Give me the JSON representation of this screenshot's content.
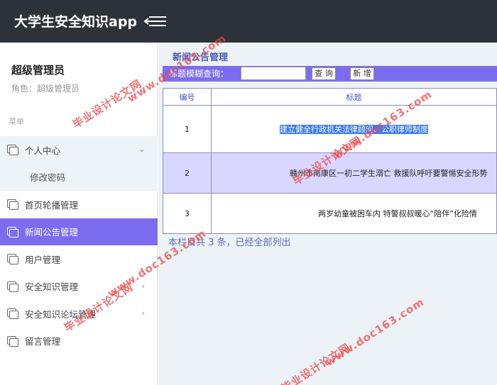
{
  "header": {
    "title": "大学生安全知识app"
  },
  "sidebar": {
    "user_name": "超级管理员",
    "user_role": "角色：超级管理员",
    "section_label": "菜单",
    "items": [
      {
        "label": "个人中心",
        "icon": "pages-icon",
        "caret": "⌄"
      },
      {
        "label": "修改密码"
      },
      {
        "label": "首页轮播管理",
        "icon": "pages-icon"
      },
      {
        "label": "新闻公告管理",
        "icon": "pages-icon"
      },
      {
        "label": "用户管理",
        "icon": "pages-icon"
      },
      {
        "label": "安全知识管理",
        "icon": "pages-icon",
        "caret": "‹"
      },
      {
        "label": "安全知识论坛管理",
        "icon": "pages-icon",
        "caret": "‹"
      },
      {
        "label": "留言管理",
        "icon": "pages-icon"
      }
    ]
  },
  "main": {
    "breadcrumb": "新闻公告管理",
    "search": {
      "label": "标题模糊查询：",
      "value": "",
      "query_button": "查 询",
      "add_button": "新 增"
    },
    "table": {
      "headers": [
        "编号",
        "标题"
      ],
      "rows": [
        {
          "id": "1",
          "title_selected": "建立健全行政机关法律顾问、公职律师制度",
          "title": ""
        },
        {
          "id": "2",
          "title": "赣州市南康区一初二学生溺亡 救援队呼吁要警惕安全形势"
        },
        {
          "id": "3",
          "title": "两岁幼童被困车内 特警叔叔暖心“陪伴”化险情"
        }
      ]
    },
    "summary": "本栏目共 3 条，已经全部列出"
  },
  "watermark": {
    "text_cn": "毕业设计论文网",
    "text_url": "www.doc163.com"
  },
  "colors": {
    "topbar": "#2d3239",
    "accent": "#7b6cf0",
    "main_bg": "#edf2f6",
    "watermark": "#f04646"
  }
}
